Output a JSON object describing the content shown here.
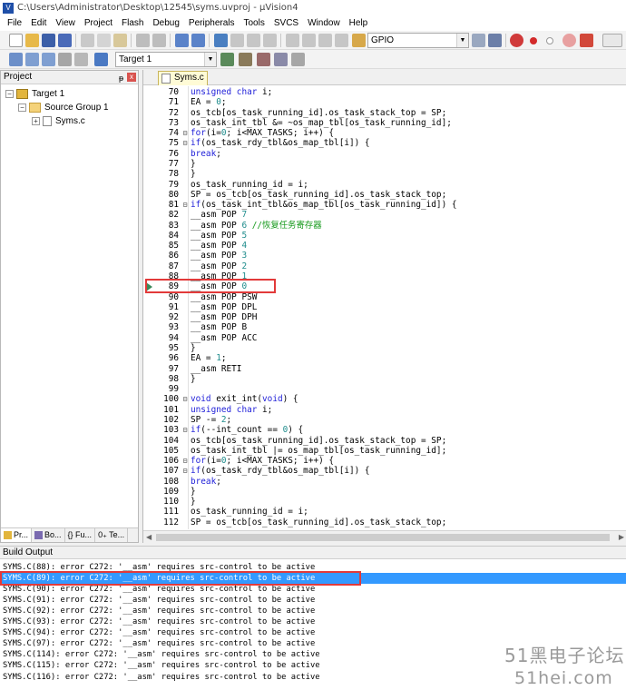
{
  "window": {
    "title": "C:\\Users\\Administrator\\Desktop\\12545\\syms.uvproj - µVision4"
  },
  "menu": [
    "File",
    "Edit",
    "View",
    "Project",
    "Flash",
    "Debug",
    "Peripherals",
    "Tools",
    "SVCS",
    "Window",
    "Help"
  ],
  "toolbar1": {
    "find_combo": "GPIO"
  },
  "toolbar2": {
    "target_combo": "Target 1"
  },
  "project": {
    "title": "Project",
    "pin": "ᵽ",
    "close": "x",
    "tree": [
      {
        "label": "Target 1",
        "expander": "−",
        "icon": "target-icon"
      },
      {
        "label": "Source Group 1",
        "expander": "−",
        "icon": "folder-icon"
      },
      {
        "label": "Syms.c",
        "expander": "+",
        "icon": "c-file-icon"
      }
    ],
    "tabs": [
      "Pr...",
      "Bo...",
      "{} Fu...",
      "0₊ Te..."
    ]
  },
  "editor": {
    "tab": "Syms.c",
    "lines": [
      {
        "n": 70,
        "fold": "",
        "parts": [
          [
            "k",
            "unsigned char"
          ],
          [
            "t",
            " i;"
          ]
        ]
      },
      {
        "n": 71,
        "fold": "",
        "parts": [
          [
            "t",
            "EA = "
          ],
          [
            "n",
            "0"
          ],
          [
            "t",
            ";"
          ]
        ]
      },
      {
        "n": 72,
        "fold": "",
        "parts": [
          [
            "t",
            "os_tcb[os_task_running_id].os_task_stack_top = SP;"
          ]
        ]
      },
      {
        "n": 73,
        "fold": "",
        "parts": [
          [
            "t",
            "os_task_int_tbl &= ~os_map_tbl[os_task_running_id];"
          ]
        ]
      },
      {
        "n": 74,
        "fold": "⊟",
        "parts": [
          [
            "k",
            "for"
          ],
          [
            "t",
            "(i="
          ],
          [
            "n",
            "0"
          ],
          [
            "t",
            "; i<MAX_TASKS; i++) {"
          ]
        ]
      },
      {
        "n": 75,
        "fold": "⊟",
        "parts": [
          [
            "k",
            "if"
          ],
          [
            "t",
            "(os_task_rdy_tbl&os_map_tbl[i]) {"
          ]
        ]
      },
      {
        "n": 76,
        "fold": "",
        "parts": [
          [
            "k",
            "break"
          ],
          [
            "t",
            ";"
          ]
        ]
      },
      {
        "n": 77,
        "fold": "",
        "parts": [
          [
            "t",
            "}"
          ]
        ]
      },
      {
        "n": 78,
        "fold": "",
        "parts": [
          [
            "t",
            "}"
          ]
        ]
      },
      {
        "n": 79,
        "fold": "",
        "parts": [
          [
            "t",
            "os_task_running_id = i;"
          ]
        ]
      },
      {
        "n": 80,
        "fold": "",
        "parts": [
          [
            "t",
            "SP = os_tcb[os_task_running_id].os_task_stack_top;"
          ]
        ]
      },
      {
        "n": 81,
        "fold": "⊟",
        "parts": [
          [
            "k",
            "if"
          ],
          [
            "t",
            "(os_task_int_tbl&os_map_tbl[os_task_running_id]) {"
          ]
        ]
      },
      {
        "n": 82,
        "fold": "",
        "parts": [
          [
            "t",
            "__asm POP "
          ],
          [
            "n",
            "7"
          ]
        ]
      },
      {
        "n": 83,
        "fold": "",
        "parts": [
          [
            "t",
            "__asm POP "
          ],
          [
            "n",
            "6"
          ],
          [
            "t",
            " "
          ],
          [
            "c",
            "//恢复任务寄存器"
          ]
        ]
      },
      {
        "n": 84,
        "fold": "",
        "parts": [
          [
            "t",
            "__asm POP "
          ],
          [
            "n",
            "5"
          ]
        ]
      },
      {
        "n": 85,
        "fold": "",
        "parts": [
          [
            "t",
            "__asm POP "
          ],
          [
            "n",
            "4"
          ]
        ]
      },
      {
        "n": 86,
        "fold": "",
        "parts": [
          [
            "t",
            "__asm POP "
          ],
          [
            "n",
            "3"
          ]
        ]
      },
      {
        "n": 87,
        "fold": "",
        "parts": [
          [
            "t",
            "__asm POP "
          ],
          [
            "n",
            "2"
          ]
        ]
      },
      {
        "n": 88,
        "fold": "",
        "parts": [
          [
            "t",
            "__asm POP "
          ],
          [
            "n",
            "1"
          ]
        ]
      },
      {
        "n": 89,
        "fold": "",
        "parts": [
          [
            "t",
            "__asm POP "
          ],
          [
            "n",
            "0"
          ]
        ]
      },
      {
        "n": 90,
        "fold": "",
        "parts": [
          [
            "t",
            "__asm POP PSW"
          ]
        ]
      },
      {
        "n": 91,
        "fold": "",
        "parts": [
          [
            "t",
            "__asm POP DPL"
          ]
        ]
      },
      {
        "n": 92,
        "fold": "",
        "parts": [
          [
            "t",
            "__asm POP DPH"
          ]
        ]
      },
      {
        "n": 93,
        "fold": "",
        "parts": [
          [
            "t",
            "__asm POP B"
          ]
        ]
      },
      {
        "n": 94,
        "fold": "",
        "parts": [
          [
            "t",
            "__asm POP ACC"
          ]
        ]
      },
      {
        "n": 95,
        "fold": "",
        "parts": [
          [
            "t",
            "}"
          ]
        ]
      },
      {
        "n": 96,
        "fold": "",
        "parts": [
          [
            "t",
            "EA = "
          ],
          [
            "n",
            "1"
          ],
          [
            "t",
            ";"
          ]
        ]
      },
      {
        "n": 97,
        "fold": "",
        "parts": [
          [
            "t",
            "__asm RETI"
          ]
        ]
      },
      {
        "n": 98,
        "fold": "",
        "parts": [
          [
            "t",
            "}"
          ]
        ]
      },
      {
        "n": 99,
        "fold": "",
        "parts": []
      },
      {
        "n": 100,
        "fold": "⊟",
        "parts": [
          [
            "k",
            "void"
          ],
          [
            "t",
            " exit_int("
          ],
          [
            "k",
            "void"
          ],
          [
            "t",
            ") {"
          ]
        ]
      },
      {
        "n": 101,
        "fold": "",
        "parts": [
          [
            "k",
            "unsigned char"
          ],
          [
            "t",
            " i;"
          ]
        ]
      },
      {
        "n": 102,
        "fold": "",
        "parts": [
          [
            "t",
            "SP -= "
          ],
          [
            "n",
            "2"
          ],
          [
            "t",
            ";"
          ]
        ]
      },
      {
        "n": 103,
        "fold": "⊟",
        "parts": [
          [
            "k",
            "if"
          ],
          [
            "t",
            "(--int_count == "
          ],
          [
            "n",
            "0"
          ],
          [
            "t",
            ") {"
          ]
        ]
      },
      {
        "n": 104,
        "fold": "",
        "parts": [
          [
            "t",
            "os_tcb[os_task_running_id].os_task_stack_top = SP;"
          ]
        ]
      },
      {
        "n": 105,
        "fold": "",
        "parts": [
          [
            "t",
            "os_task_int_tbl |= os_map_tbl[os_task_running_id];"
          ]
        ]
      },
      {
        "n": 106,
        "fold": "⊟",
        "parts": [
          [
            "k",
            "for"
          ],
          [
            "t",
            "(i="
          ],
          [
            "n",
            "0"
          ],
          [
            "t",
            "; i<MAX_TASKS; i++) {"
          ]
        ]
      },
      {
        "n": 107,
        "fold": "⊟",
        "parts": [
          [
            "k",
            "if"
          ],
          [
            "t",
            "(os_task_rdy_tbl&os_map_tbl[i]) {"
          ]
        ]
      },
      {
        "n": 108,
        "fold": "",
        "parts": [
          [
            "k",
            "break"
          ],
          [
            "t",
            ";"
          ]
        ]
      },
      {
        "n": 109,
        "fold": "",
        "parts": [
          [
            "t",
            "}"
          ]
        ]
      },
      {
        "n": 110,
        "fold": "",
        "parts": [
          [
            "t",
            "}"
          ]
        ]
      },
      {
        "n": 111,
        "fold": "",
        "parts": [
          [
            "t",
            "os_task_running_id = i;"
          ]
        ]
      },
      {
        "n": 112,
        "fold": "",
        "parts": [
          [
            "t",
            "SP = os_tcb[os_task_running_id].os_task_stack_top;"
          ]
        ]
      }
    ],
    "current_line": 89
  },
  "build": {
    "title": "Build Output",
    "lines": [
      "SYMS.C(88): error C272: '__asm' requires src-control to be active",
      "SYMS.C(89): error C272: '__asm' requires src-control to be active",
      "SYMS.C(90): error C272: '__asm' requires src-control to be active",
      "SYMS.C(91): error C272: '__asm' requires src-control to be active",
      "SYMS.C(92): error C272: '__asm' requires src-control to be active",
      "SYMS.C(93): error C272: '__asm' requires src-control to be active",
      "SYMS.C(94): error C272: '__asm' requires src-control to be active",
      "SYMS.C(97): error C272: '__asm' requires src-control to be active",
      "SYMS.C(114): error C272: '__asm' requires src-control to be active",
      "SYMS.C(115): error C272: '__asm' requires src-control to be active",
      "SYMS.C(116): error C272: '__asm' requires src-control to be active"
    ],
    "selected_index": 1
  },
  "watermark": {
    "line1": "51黑电子论坛",
    "line2": "51hei.com"
  }
}
